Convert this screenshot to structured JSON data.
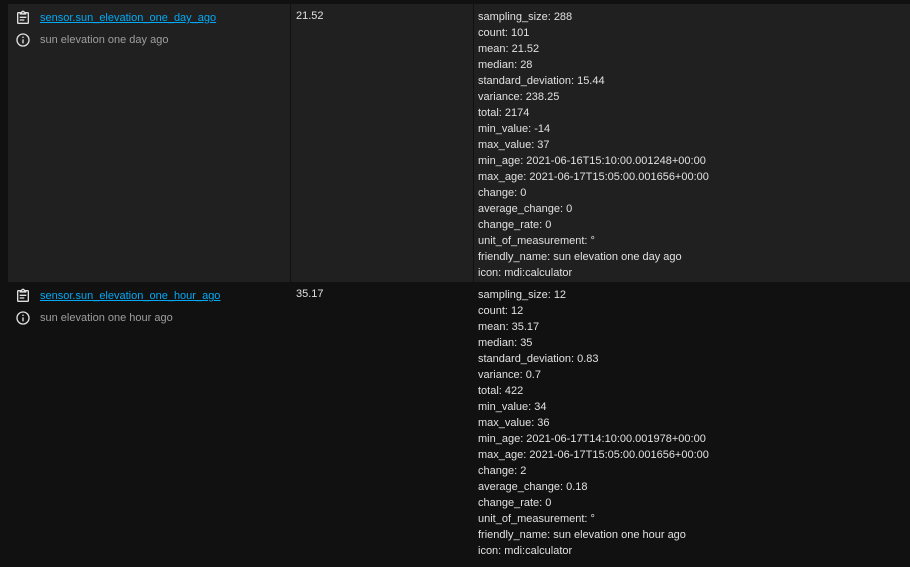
{
  "rows": [
    {
      "entity_id": "sensor.sun_elevation_one_day_ago",
      "friendly_name": "sun elevation one day ago",
      "state": "21.52",
      "attributes": [
        "sampling_size: 288",
        "count: 101",
        "mean: 21.52",
        "median: 28",
        "standard_deviation: 15.44",
        "variance: 238.25",
        "total: 2174",
        "min_value: -14",
        "max_value: 37",
        "min_age: 2021-06-16T15:10:00.001248+00:00",
        "max_age: 2021-06-17T15:05:00.001656+00:00",
        "change: 0",
        "average_change: 0",
        "change_rate: 0",
        "unit_of_measurement: °",
        "friendly_name: sun elevation one day ago",
        "icon: mdi:calculator"
      ]
    },
    {
      "entity_id": "sensor.sun_elevation_one_hour_ago",
      "friendly_name": "sun elevation one hour ago",
      "state": "35.17",
      "attributes": [
        "sampling_size: 12",
        "count: 12",
        "mean: 35.17",
        "median: 35",
        "standard_deviation: 0.83",
        "variance: 0.7",
        "total: 422",
        "min_value: 34",
        "max_value: 36",
        "min_age: 2021-06-17T14:10:00.001978+00:00",
        "max_age: 2021-06-17T15:05:00.001656+00:00",
        "change: 2",
        "average_change: 0.18",
        "change_rate: 0",
        "unit_of_measurement: °",
        "friendly_name: sun elevation one hour ago",
        "icon: mdi:calculator"
      ]
    }
  ],
  "icons": {
    "copy": "clipboard-copy-icon",
    "info": "info-circle-icon"
  },
  "colors": {
    "link": "#03a9f4",
    "row_alt": "#202020",
    "background": "#111111"
  }
}
